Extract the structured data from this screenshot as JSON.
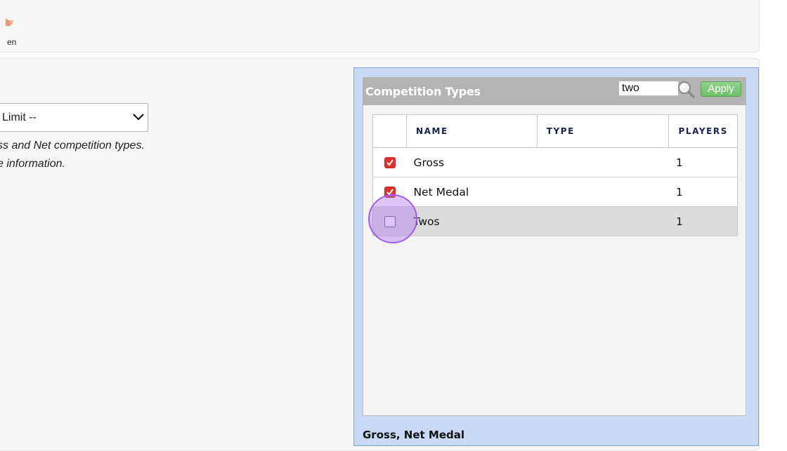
{
  "toolbar": {
    "partial_label": "en",
    "icon": "person-icon"
  },
  "form": {
    "handicap_select": {
      "value": "Limit --"
    },
    "note_line_1": "ss and Net competition types.",
    "note_line_2": "e information."
  },
  "competition_types": {
    "title": "Competition Types",
    "search": {
      "value": "two",
      "icon": "search-icon"
    },
    "apply_label": "Apply",
    "columns": [
      "NAME",
      "TYPE",
      "PLAYERS"
    ],
    "rows": [
      {
        "checked": true,
        "name": "Gross",
        "type": "",
        "players": "1"
      },
      {
        "checked": true,
        "name": "Net Medal",
        "type": "",
        "players": "1"
      },
      {
        "checked": false,
        "name": "Twos",
        "type": "",
        "players": "1"
      }
    ],
    "selected_summary": "Gross, Net Medal"
  },
  "colors": {
    "panel_bg": "#c8daf5",
    "header_bg": "#b4b4b4",
    "checkbox_on": "#e03030",
    "apply_green": "#6ec06a",
    "click_indicator": "#a05ee8"
  }
}
